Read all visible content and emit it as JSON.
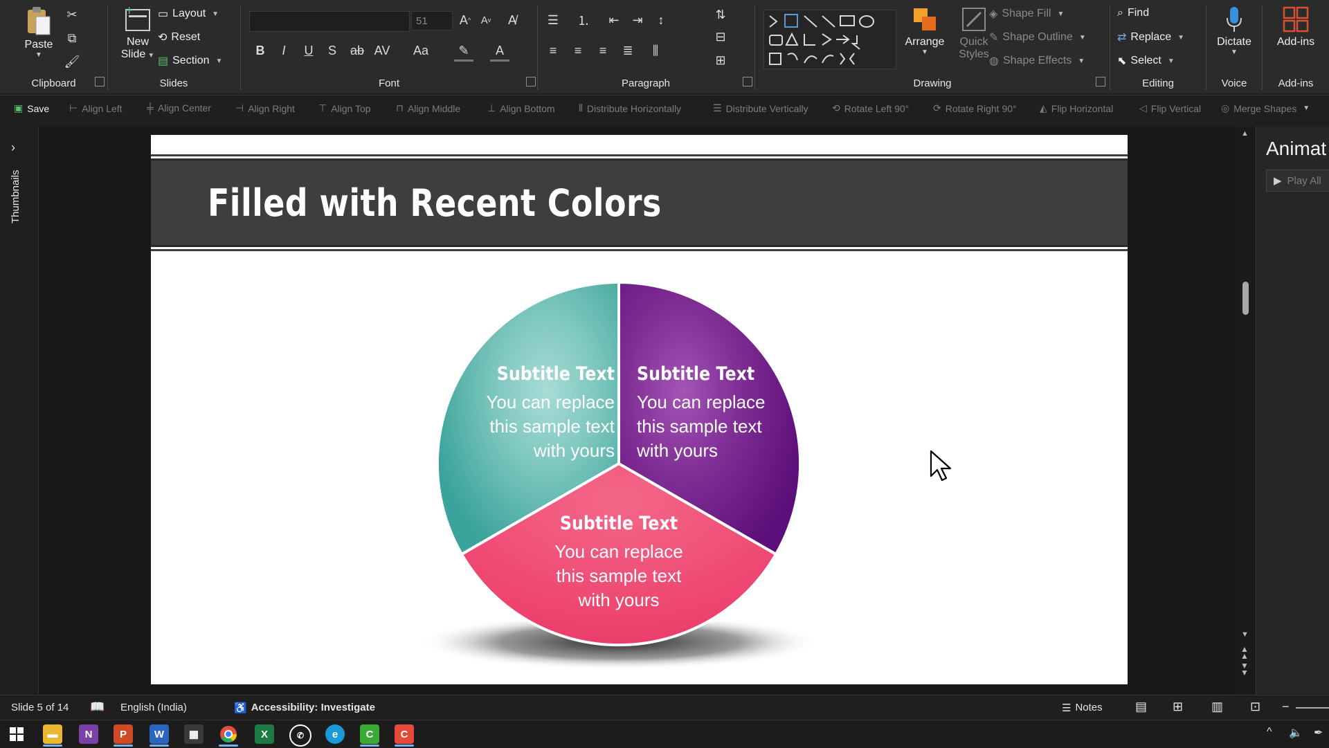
{
  "ribbon": {
    "clipboard": {
      "paste": "Paste",
      "label": "Clipboard"
    },
    "slides": {
      "new_slide": "New Slide",
      "layout": "Layout",
      "reset": "Reset",
      "section": "Section",
      "label": "Slides"
    },
    "font": {
      "font_size": "51",
      "label": "Font"
    },
    "paragraph": {
      "label": "Paragraph"
    },
    "drawing": {
      "arrange": "Arrange",
      "quick_styles": "Quick Styles",
      "shape_fill": "Shape Fill",
      "shape_outline": "Shape Outline",
      "shape_effects": "Shape Effects",
      "label": "Drawing"
    },
    "editing": {
      "find": "Find",
      "replace": "Replace",
      "select": "Select",
      "label": "Editing"
    },
    "voice": {
      "dictate": "Dictate",
      "label": "Voice"
    },
    "addins": {
      "addins": "Add-ins",
      "label": "Add-ins"
    }
  },
  "qat": {
    "save": "Save",
    "items": [
      "Align Left",
      "Align Center",
      "Align Right",
      "Align Top",
      "Align Middle",
      "Align Bottom",
      "Distribute Horizontally",
      "Distribute Vertically",
      "Rotate Left 90°",
      "Rotate Right 90°",
      "Flip Horizontal",
      "Flip Vertical",
      "Merge Shapes"
    ]
  },
  "thumbnails": {
    "label": "Thumbnails"
  },
  "slide": {
    "title": "Filled with Recent Colors",
    "segments": [
      {
        "subtitle": "Subtitle Text",
        "l1": "You can replace",
        "l2": "this sample text",
        "l3": "with yours",
        "color": "#4aaaa3"
      },
      {
        "subtitle": "Subtitle Text",
        "l1": "You can replace",
        "l2": "this sample text",
        "l3": "with yours",
        "color": "#6a1b8a"
      },
      {
        "subtitle": "Subtitle Text",
        "l1": "You can replace",
        "l2": "this sample text",
        "l3": "with yours",
        "color": "#ee4672"
      }
    ]
  },
  "animation_pane": {
    "title": "Animat",
    "play_all": "Play All"
  },
  "status": {
    "slide_counter": "Slide 5 of 14",
    "language": "English (India)",
    "accessibility": "Accessibility: Investigate",
    "notes": "Notes"
  },
  "taskbar": {
    "apps": [
      "Start",
      "File Explorer",
      "OneNote",
      "PowerPoint",
      "Word",
      "Calculator",
      "Chrome",
      "Excel",
      "WhatsApp",
      "Edge",
      "Camtasia Green",
      "Camtasia Red"
    ]
  }
}
